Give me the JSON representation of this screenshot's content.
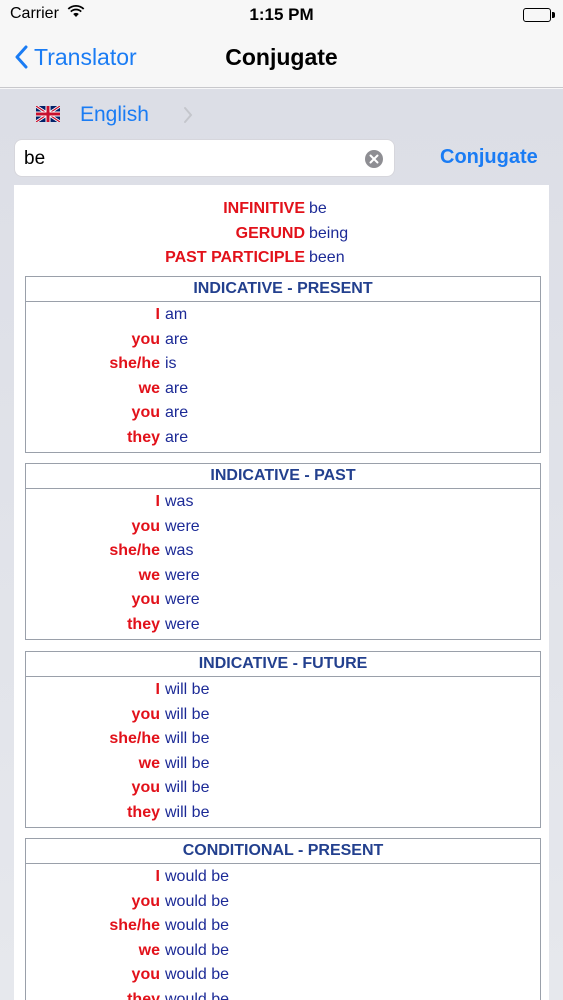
{
  "status_bar": {
    "carrier": "Carrier",
    "time": "1:15 PM"
  },
  "nav": {
    "back_label": "Translator",
    "title": "Conjugate"
  },
  "language": {
    "name": "English"
  },
  "search": {
    "value": "be",
    "button_label": "Conjugate"
  },
  "forms": [
    {
      "label": "INFINITIVE",
      "value": "be"
    },
    {
      "label": "GERUND",
      "value": "being"
    },
    {
      "label": "PAST PARTICIPLE",
      "value": "been"
    }
  ],
  "tenses": [
    {
      "title": "INDICATIVE - PRESENT",
      "rows": [
        {
          "pronoun": "I",
          "verb": "am"
        },
        {
          "pronoun": "you",
          "verb": "are"
        },
        {
          "pronoun": "she/he",
          "verb": "is"
        },
        {
          "pronoun": "we",
          "verb": "are"
        },
        {
          "pronoun": "you",
          "verb": "are"
        },
        {
          "pronoun": "they",
          "verb": "are"
        }
      ]
    },
    {
      "title": "INDICATIVE - PAST",
      "rows": [
        {
          "pronoun": "I",
          "verb": "was"
        },
        {
          "pronoun": "you",
          "verb": "were"
        },
        {
          "pronoun": "she/he",
          "verb": "was"
        },
        {
          "pronoun": "we",
          "verb": "were"
        },
        {
          "pronoun": "you",
          "verb": "were"
        },
        {
          "pronoun": "they",
          "verb": "were"
        }
      ]
    },
    {
      "title": "INDICATIVE - FUTURE",
      "rows": [
        {
          "pronoun": "I",
          "verb": "will be"
        },
        {
          "pronoun": "you",
          "verb": "will be"
        },
        {
          "pronoun": "she/he",
          "verb": "will be"
        },
        {
          "pronoun": "we",
          "verb": "will be"
        },
        {
          "pronoun": "you",
          "verb": "will be"
        },
        {
          "pronoun": "they",
          "verb": "will be"
        }
      ]
    },
    {
      "title": "CONDITIONAL - PRESENT",
      "rows": [
        {
          "pronoun": "I",
          "verb": "would be"
        },
        {
          "pronoun": "you",
          "verb": "would be"
        },
        {
          "pronoun": "she/he",
          "verb": "would be"
        },
        {
          "pronoun": "we",
          "verb": "would be"
        },
        {
          "pronoun": "you",
          "verb": "would be"
        },
        {
          "pronoun": "they",
          "verb": "would be"
        }
      ]
    }
  ]
}
